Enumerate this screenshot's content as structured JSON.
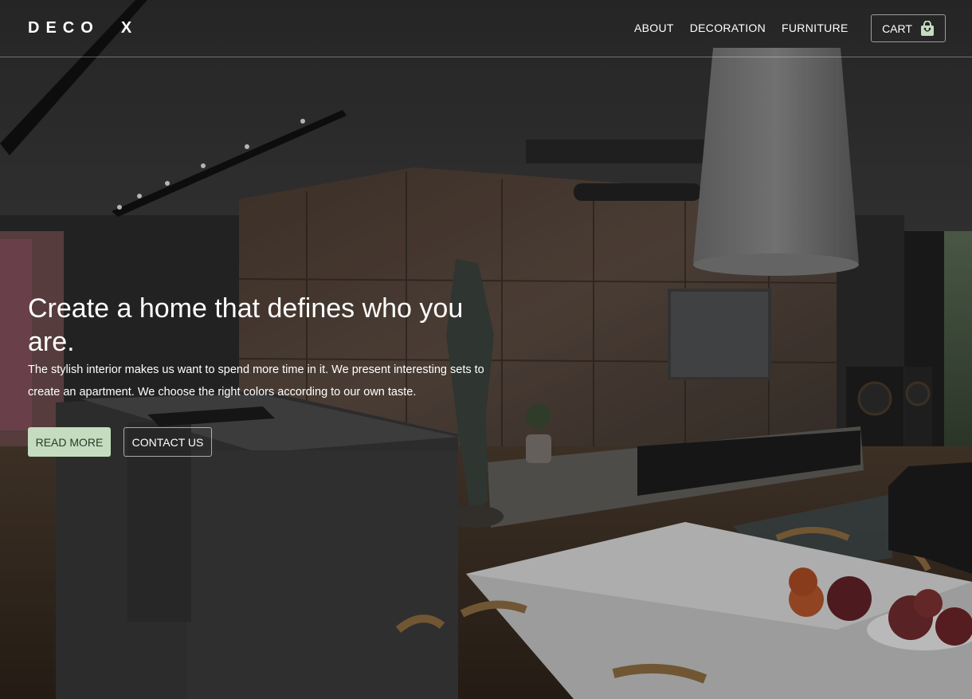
{
  "brand": {
    "logo_text": "DECO  X"
  },
  "nav": {
    "items": [
      {
        "label": "ABOUT"
      },
      {
        "label": "DECORATION"
      },
      {
        "label": "FURNITURE"
      }
    ],
    "cart_label": "CART",
    "cart_icon": "shopping-bag-icon"
  },
  "hero": {
    "headline": "Create a home that defines who you are.",
    "description": "The stylish interior makes us want to spend more time in it. We present interesting sets to create an apartment. We choose the right colors according to our own taste.",
    "read_more_label": "READ MORE",
    "contact_label": "CONTACT US"
  },
  "colors": {
    "accent": "#c5dcc0",
    "text": "#ffffff"
  }
}
